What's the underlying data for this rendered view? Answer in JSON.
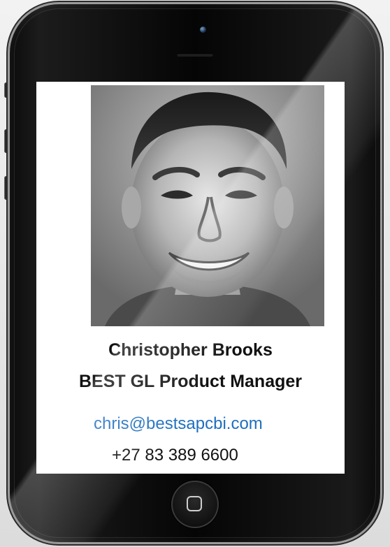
{
  "contact": {
    "name": "Christopher Brooks",
    "title": "BEST GL Product Manager",
    "email": "chris@bestsapcbi.com",
    "phone": "+27 83 389 6600"
  },
  "colors": {
    "email_link": "#1f6fbf",
    "screen_background": "#ffffff",
    "phone_body": "#0b0b0b"
  },
  "icons": {
    "home_button": "home-square-icon"
  }
}
